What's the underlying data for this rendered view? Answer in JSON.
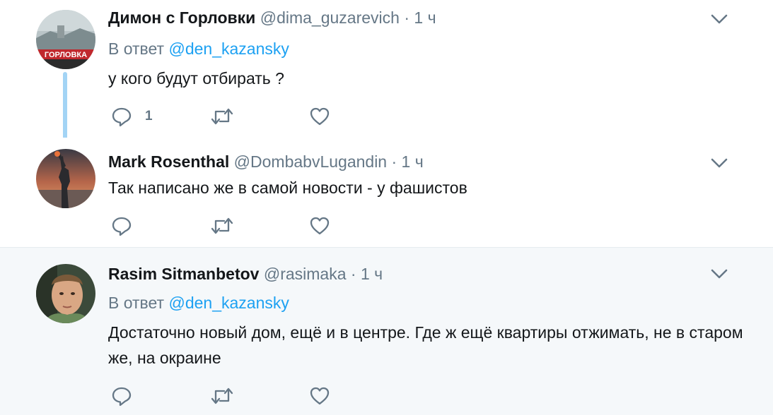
{
  "tweets": [
    {
      "name": "Димон с Горловки",
      "handle": "@dima_guzarevich",
      "separator": "·",
      "time": "1 ч",
      "reply_prefix": "В ответ",
      "reply_to": "@den_kazansky",
      "text": "у кого будут отбирать ?",
      "reply_count": "1",
      "avatar_text": "ГОРЛОВКА"
    },
    {
      "name": "Mark Rosenthal",
      "handle": "@DombabvLugandin",
      "separator": "·",
      "time": "1 ч",
      "text": "Так написано же в самой новости - у фашистов"
    },
    {
      "name": "Rasim Sitmanbetov",
      "handle": "@rasimaka",
      "separator": "·",
      "time": "1 ч",
      "reply_prefix": "В ответ",
      "reply_to": "@den_kazansky",
      "text": "Достаточно новый дом, ещё и в центре. Где ж ещё квартиры отжимать, не в старом же, на окраине"
    }
  ],
  "colors": {
    "link": "#1da1f2",
    "muted": "#657786",
    "thread_line": "#a3d4f5",
    "highlight_bg": "#f5f8fa"
  },
  "icons": [
    "reply-icon",
    "retweet-icon",
    "like-icon",
    "chevron-down-icon"
  ]
}
